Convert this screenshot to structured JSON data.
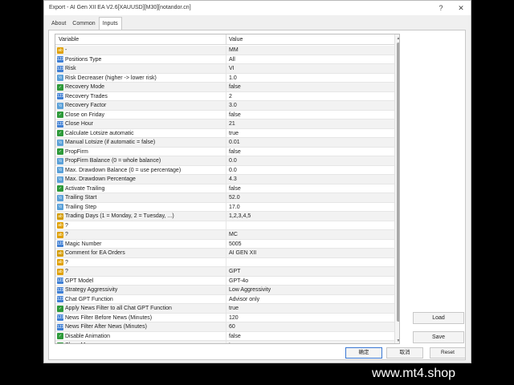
{
  "window": {
    "title": "Export - AI Gen XII EA V2.6[XAUUSD][M30][notandor.cn]",
    "help": "?",
    "close": "✕"
  },
  "tabs": [
    {
      "label": "About"
    },
    {
      "label": "Common"
    },
    {
      "label": "Inputs"
    }
  ],
  "grid": {
    "header_variable": "Variable",
    "header_value": "Value",
    "rows": [
      {
        "icon": "enum",
        "name": "-",
        "value": "MM"
      },
      {
        "icon": "num",
        "name": "Positions Type",
        "value": "All"
      },
      {
        "icon": "num",
        "name": "Risk",
        "value": "VI"
      },
      {
        "icon": "dbl",
        "name": "Risk Decreaser (higher -> lower risk)",
        "value": "1.0"
      },
      {
        "icon": "bool",
        "name": "Recovery Mode",
        "value": "false"
      },
      {
        "icon": "num",
        "name": "Recovery Trades",
        "value": "2"
      },
      {
        "icon": "dbl",
        "name": "Recovery Factor",
        "value": "3.0"
      },
      {
        "icon": "bool",
        "name": "Close on Friday",
        "value": "false"
      },
      {
        "icon": "num",
        "name": "Close Hour",
        "value": "21"
      },
      {
        "icon": "bool",
        "name": "Calculate Lotsize automatic",
        "value": "true"
      },
      {
        "icon": "dbl",
        "name": "Manual Lotsize (if automatic = false)",
        "value": "0.01"
      },
      {
        "icon": "bool",
        "name": "PropFirm",
        "value": "false"
      },
      {
        "icon": "dbl",
        "name": "PropFirm Balance (0 = whole balance)",
        "value": "0.0"
      },
      {
        "icon": "dbl",
        "name": "Max. Drawdown Balance (0 = use percentage)",
        "value": "0.0"
      },
      {
        "icon": "dbl",
        "name": "Max. Drawdown Percentage",
        "value": "4.3"
      },
      {
        "icon": "bool",
        "name": "Activate Trailing",
        "value": "false"
      },
      {
        "icon": "dbl",
        "name": "Trailing Start",
        "value": "52.0"
      },
      {
        "icon": "dbl",
        "name": "Trailing Step",
        "value": "17.0"
      },
      {
        "icon": "str",
        "name": "Trading Days (1 = Monday, 2 = Tuesday, ...)",
        "value": "1,2,3,4,5"
      },
      {
        "icon": "enum",
        "name": "?",
        "value": ""
      },
      {
        "icon": "enum",
        "name": "?",
        "value": "MC"
      },
      {
        "icon": "num",
        "name": "Magic Number",
        "value": "5005"
      },
      {
        "icon": "str",
        "name": "Comment for EA Orders",
        "value": "AI GEN XII"
      },
      {
        "icon": "enum",
        "name": "?",
        "value": ""
      },
      {
        "icon": "enum",
        "name": "?",
        "value": "GPT"
      },
      {
        "icon": "num",
        "name": "GPT Model",
        "value": "GPT-4o"
      },
      {
        "icon": "num",
        "name": "Strategy Aggressivity",
        "value": "Low Aggressivity"
      },
      {
        "icon": "num",
        "name": "Chat GPT Function",
        "value": "Advisor only"
      },
      {
        "icon": "bool",
        "name": "Apply News Filter to all Chat GPT Function",
        "value": "true"
      },
      {
        "icon": "num",
        "name": "News Filter Before News (Minutes)",
        "value": "120"
      },
      {
        "icon": "num",
        "name": "News Filter After News (Minutes)",
        "value": "60"
      },
      {
        "icon": "bool",
        "name": "Disable Animation",
        "value": "false"
      },
      {
        "icon": "bool",
        "name": "Show Menu",
        "value": "true"
      }
    ]
  },
  "buttons": {
    "load": "Load",
    "save": "Save",
    "ok": "确定",
    "cancel": "取消",
    "reset": "Reset"
  },
  "watermark": "www.mt4.shop"
}
